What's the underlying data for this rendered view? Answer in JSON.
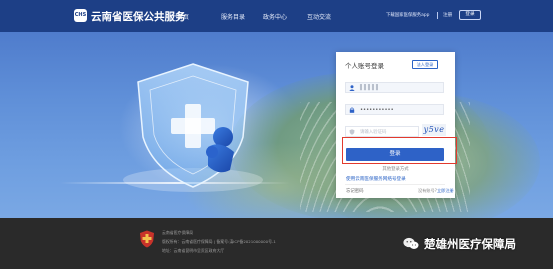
{
  "header": {
    "logo_text": "CHS",
    "site_title": "云南省医保公共服务",
    "nav": [
      {
        "label": "首页"
      },
      {
        "label": "服务目录"
      },
      {
        "label": "政务中心"
      },
      {
        "label": "互动交流"
      }
    ],
    "app_download": "下载国家医保服务app",
    "register": "注册",
    "login": "登录"
  },
  "login_card": {
    "title": "个人账号登录",
    "switch_tag": "法人登录",
    "username_value": "▌▌▌▌▌",
    "password_value": "•••••••••••",
    "captcha_placeholder": "请输入验证码",
    "captcha_code": "y5ve",
    "login_button": "登录",
    "other_methods": "其他登录方式",
    "alt_login_link": "使用云南医保服务网络号登录",
    "forgot_password": "忘记密码",
    "no_account_prefix": "没有账号?",
    "register_now": "立即注册"
  },
  "footer": {
    "lines": [
      "云南省医疗保障局",
      "版权所有：云南省医疗保障局 | 备案号:滇ICP备2021000000号-1",
      "地址：云南省昆明市呈贡区政府大厅"
    ]
  },
  "watermark": {
    "text": "楚雄州医疗保障局"
  },
  "colors": {
    "header_bg": "#1d3f86",
    "primary": "#2e62c7",
    "highlight": "#e23a2e",
    "footer_bg": "#2a2a2a"
  }
}
